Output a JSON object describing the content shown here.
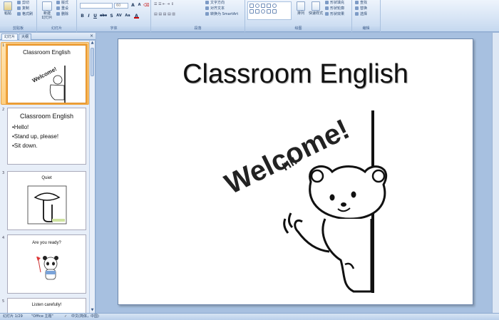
{
  "ribbon": {
    "clipboard": {
      "paste_label": "粘贴",
      "cut_label": "剪切",
      "copy_label": "复制",
      "format_painter_label": "格式刷",
      "group_label": "剪贴板"
    },
    "slides": {
      "new_slide_label": "新建\n幻灯片",
      "layout_label": "版式",
      "reset_label": "重设",
      "delete_label": "删除",
      "group_label": "幻灯片"
    },
    "font": {
      "font_name": "",
      "font_size": "60",
      "group_label": "字体",
      "bold_label": "B",
      "italic_label": "I",
      "underline_label": "U",
      "strike_label": "abc",
      "shadow_label": "S",
      "spacing_label": "AV",
      "case_label": "Aa",
      "color_label": "A"
    },
    "paragraph": {
      "text_direction_label": "文字方向",
      "align_text_label": "对齐文本",
      "smartart_label": "转换为 SmartArt",
      "group_label": "段落"
    },
    "drawing": {
      "arrange_label": "排列",
      "quick_styles_label": "快速样式",
      "fill_label": "形状填充",
      "outline_label": "形状轮廓",
      "effects_label": "形状效果",
      "group_label": "绘图"
    },
    "editing": {
      "find_label": "查找",
      "replace_label": "替换",
      "select_label": "选择",
      "group_label": "编辑"
    }
  },
  "left_pane": {
    "tabs": [
      {
        "label": "幻灯片"
      },
      {
        "label": "大纲"
      }
    ],
    "close": "×",
    "thumbnails": [
      {
        "num": "1",
        "title": "Classroom English"
      },
      {
        "num": "2",
        "title": "Classroom English",
        "bullets": [
          "•Hello!",
          "•Stand up, please!",
          "•Sit down."
        ]
      },
      {
        "num": "3",
        "title": "Quiet"
      },
      {
        "num": "4",
        "title": "Are you ready?"
      },
      {
        "num": "5",
        "title": "Listen carefully!"
      }
    ]
  },
  "slide": {
    "title": "Classroom English",
    "welcome": "Welcome!",
    "hi": "Hi!"
  },
  "statusbar": {
    "slide_info": "幻灯片 1/29",
    "theme": "\"Office 主题\"",
    "language": "中文(简体，中国)"
  },
  "colors": {
    "ribbon_top": "#eef4fc",
    "selection": "#f0a33c",
    "workspace": "#a7c0e0"
  },
  "icons": [
    "scissors-icon",
    "copy-icon",
    "format-painter-icon",
    "paste-icon",
    "new-slide-icon",
    "find-icon",
    "replace-icon",
    "select-icon"
  ]
}
